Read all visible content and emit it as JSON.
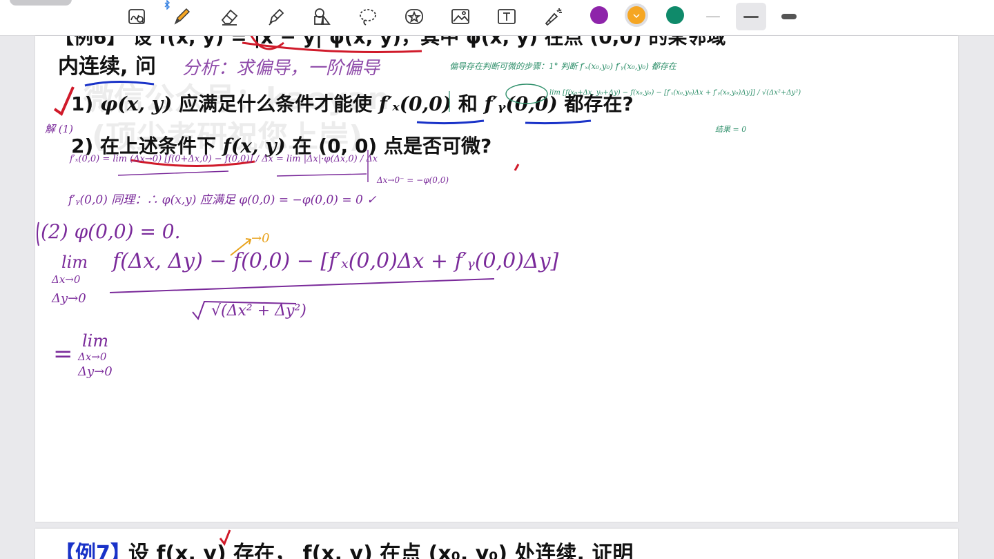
{
  "toolbar": {
    "tools": [
      {
        "name": "lasso-zoom",
        "icon": "lasso-zoom-icon"
      },
      {
        "name": "pen",
        "icon": "pen-icon"
      },
      {
        "name": "eraser",
        "icon": "eraser-icon"
      },
      {
        "name": "highlighter",
        "icon": "highlighter-icon"
      },
      {
        "name": "shapes",
        "icon": "shapes-icon"
      },
      {
        "name": "lasso",
        "icon": "lasso-icon"
      },
      {
        "name": "sticker",
        "icon": "sticker-icon"
      },
      {
        "name": "image",
        "icon": "image-icon"
      },
      {
        "name": "text",
        "icon": "text-icon"
      },
      {
        "name": "laser-pointer",
        "icon": "laser-pointer-icon"
      }
    ],
    "colors": [
      "#8e24aa",
      "#f5a623",
      "#0f8a6a"
    ],
    "selected_color": "#f5a623",
    "stroke_widths": [
      "thin",
      "medium",
      "thick"
    ],
    "selected_stroke": "medium"
  },
  "page1": {
    "top_line": "【例6】 设 f(x, y) = |x − y| φ(x, y)，其中 φ(x, y) 在点 (0,0) 的某邻域",
    "line1": "内连续, 问",
    "q1_prefix": "1) ",
    "q1_phi": "φ(x, y)",
    "q1_mid": " 应满足什么条件才能使 ",
    "q1_fx": "f′ₓ(0,0)",
    "q1_and": " 和 ",
    "q1_fy": "f′ᵧ(0,0)",
    "q1_end": " 都存在?",
    "q2_prefix": "2) ",
    "q2_cond": "在上述条件下 ",
    "q2_f": "f(x, y)",
    "q2_end": " 在 (0, 0) 点是否可微?",
    "watermark1": "微信公众号：kaoyan",
    "watermark2": "(顶尖考研祝您上岸)",
    "notes": {
      "analysis": "分析：求偏导，一阶偏导",
      "green_note": "偏导存在判断可微的步骤：1° 判断 f′ₓ(x₀,y₀) f′ᵧ(x₀,y₀) 都存在",
      "green_lim": "lim [f(x₀+Δx, y₀+Δy) − f(x₀,y₀) − [f′ₓ(x₀,y₀)Δx + f′ᵧ(x₀,y₀)Δy]] / √(Δx²+Δy²)",
      "green_eq": "结果 = 0",
      "jie": "解 (1)",
      "fx_def": "f′ₓ(0,0) = lim (Δx→0) [f(0+Δx,0) − f(0,0)] / Δx = lim |Δx|·φ(Δx,0) / Δx",
      "fx_tail": "Δx→0⁻ = −φ(0,0)",
      "fy_same": "f′ᵧ(0,0) 同理：∴ φ(x,y) 应满足 φ(0,0) = −φ(0,0) = 0 ✓",
      "part2": "(2)  φ(0,0) = 0.",
      "lim": "lim",
      "lim_sub1": "Δx→0",
      "lim_sub2": "Δy→0",
      "numerator": "f(Δx, Δy) − f(0,0) − [f′ₓ(0,0)Δx + f′ᵧ(0,0)Δy]",
      "denominator": "√(Δx² + Δy²)",
      "arrow_label": "→0",
      "eq_sign": "=",
      "lim2": "lim",
      "lim2_sub1": "Δx→0",
      "lim2_sub2": "Δy→0"
    }
  },
  "page2": {
    "label": "【例7】",
    "text": "设  f(x, y) 存在， f(x, y) 在点 (x₀, y₀) 处连续, 证明"
  }
}
